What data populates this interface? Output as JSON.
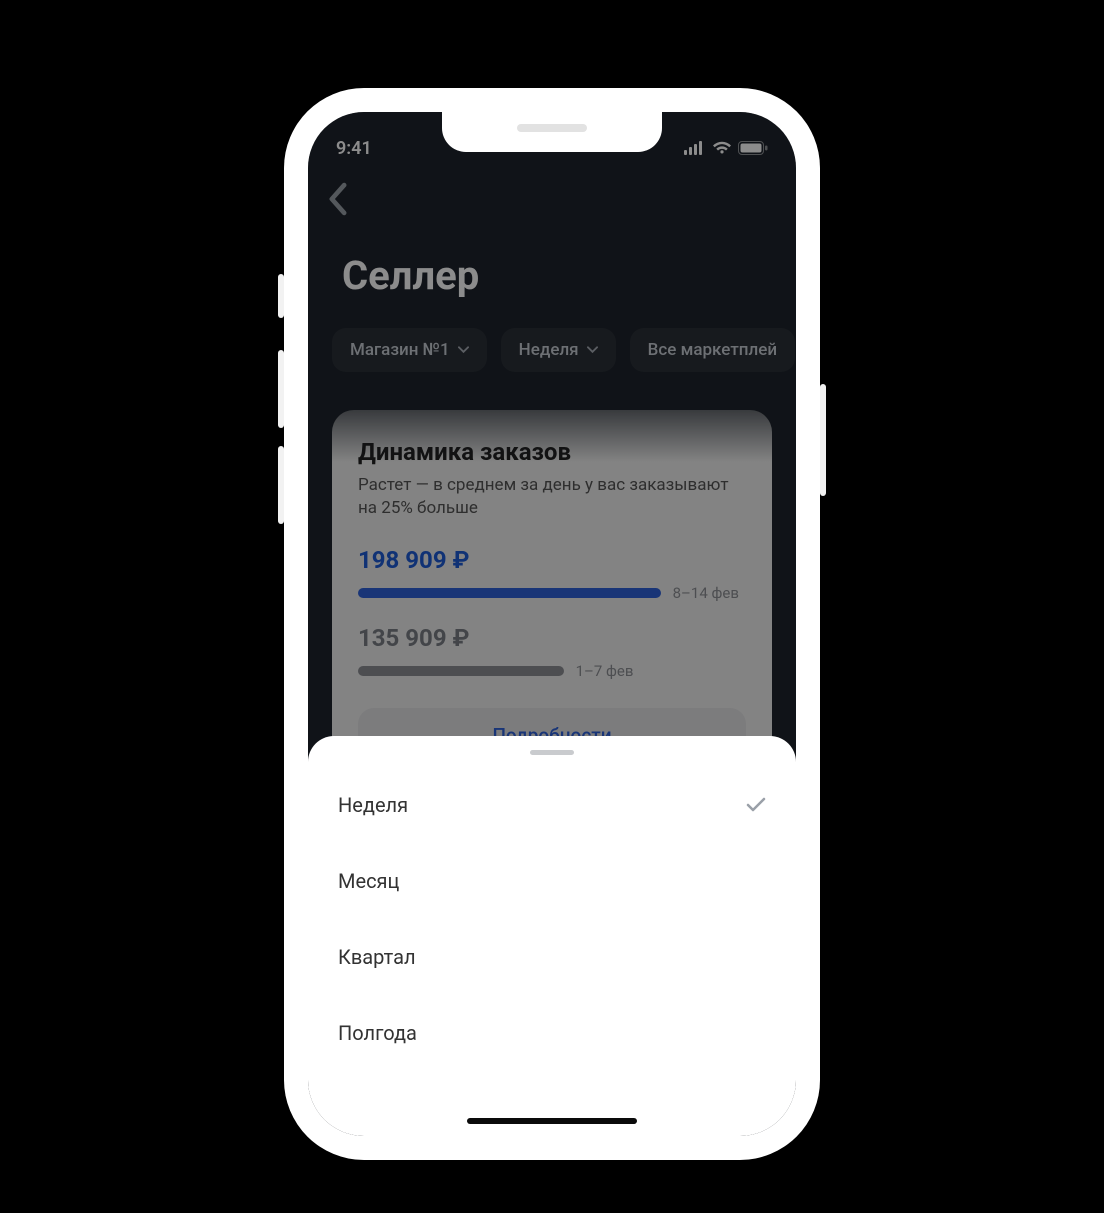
{
  "status_bar": {
    "time": "9:41"
  },
  "header": {
    "title": "Селлер"
  },
  "filters": {
    "store": {
      "label": "Магазин №1"
    },
    "period": {
      "label": "Неделя"
    },
    "marketplace": {
      "label": "Все маркетплей"
    }
  },
  "orders_card": {
    "title": "Динамика заказов",
    "subtitle": "Растет — в среднем за день у вас заказывают на 25% больше",
    "current": {
      "value": "198 909 ₽",
      "range_label": "8–14 фев"
    },
    "previous": {
      "value": "135 909 ₽",
      "range_label": "1–7 фев"
    },
    "details_label": "Подробности"
  },
  "period_sheet": {
    "options": [
      {
        "label": "Неделя",
        "selected": true
      },
      {
        "label": "Месяц",
        "selected": false
      },
      {
        "label": "Квартал",
        "selected": false
      },
      {
        "label": "Полгода",
        "selected": false
      }
    ]
  },
  "chart_data": {
    "type": "bar",
    "title": "Динамика заказов",
    "ylabel": "₽",
    "categories": [
      "1–7 фев",
      "8–14 фев"
    ],
    "values": [
      135909,
      198909
    ]
  },
  "colors": {
    "accent": "#2f62d9",
    "bg_dark": "#1e242c",
    "muted_text": "#8c8f94"
  }
}
